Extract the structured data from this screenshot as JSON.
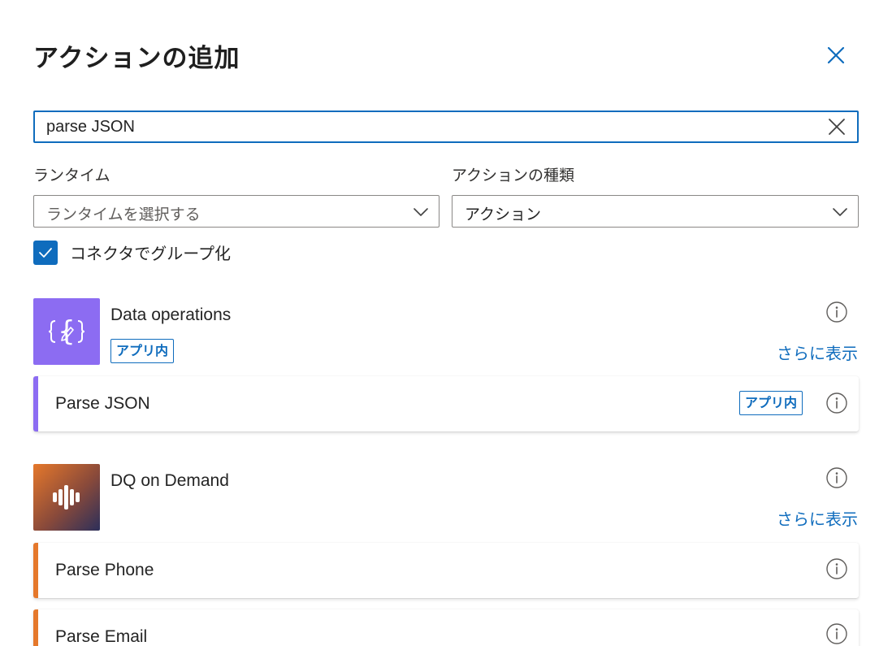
{
  "dialog": {
    "title": "アクションの追加"
  },
  "search": {
    "value": "parse JSON"
  },
  "filters": {
    "runtime_label": "ランタイム",
    "runtime_placeholder": "ランタイムを選択する",
    "action_type_label": "アクションの種類",
    "action_type_value": "アクション"
  },
  "group_by_connector": {
    "label": "コネクタでグループ化",
    "checked": true
  },
  "connectors": [
    {
      "name": "Data operations",
      "badge": "アプリ内",
      "more_label": "さらに表示",
      "icon": "curly-braces-pencil-icon",
      "color": "#8c6cf2",
      "actions": [
        {
          "label": "Parse JSON",
          "badge": "アプリ内"
        }
      ]
    },
    {
      "name": "DQ on Demand",
      "more_label": "さらに表示",
      "icon": "sound-bars-icon",
      "color": "#e5782b",
      "actions": [
        {
          "label": "Parse Phone"
        },
        {
          "label": "Parse Email"
        }
      ]
    }
  ],
  "colors": {
    "accent": "#0f6cbd",
    "data_operations": "#8c6cf2",
    "dq_on_demand": "#e5782b"
  }
}
